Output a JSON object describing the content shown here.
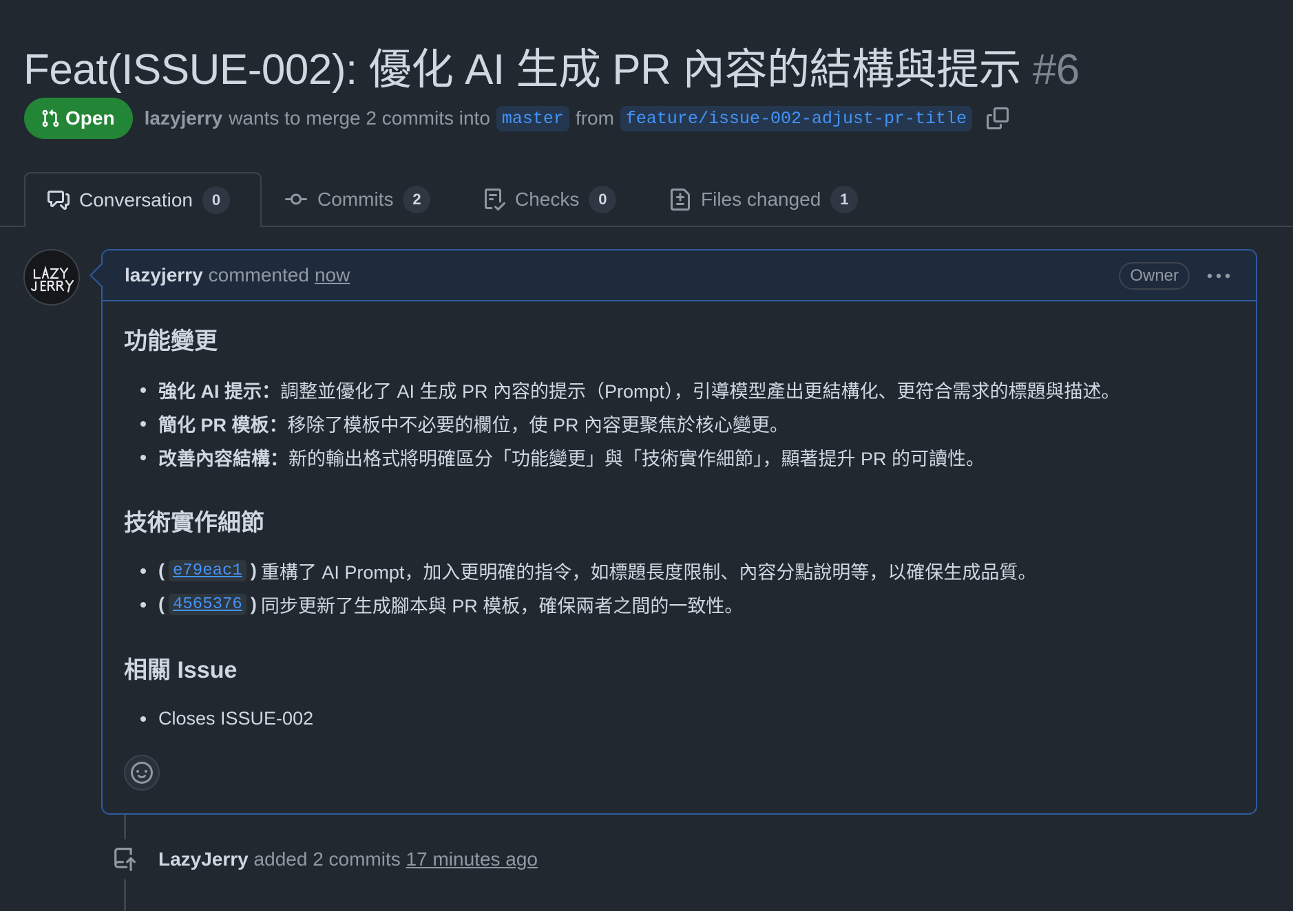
{
  "pr": {
    "title": "Feat(ISSUE-002): 優化 AI 生成 PR 內容的結構與提示",
    "number": "#6",
    "state": "Open",
    "author": "lazyjerry",
    "merge_text": "wants to merge 2 commits into",
    "base_branch": "master",
    "from_text": "from",
    "head_branch": "feature/issue-002-adjust-pr-title"
  },
  "tabs": [
    {
      "label": "Conversation",
      "count": "0",
      "icon": "comment-discussion-icon"
    },
    {
      "label": "Commits",
      "count": "2",
      "icon": "git-commit-icon"
    },
    {
      "label": "Checks",
      "count": "0",
      "icon": "checklist-icon"
    },
    {
      "label": "Files changed",
      "count": "1",
      "icon": "file-diff-icon"
    }
  ],
  "comment": {
    "author": "lazyjerry",
    "action": "commented",
    "time": "now",
    "badge": "Owner",
    "sections": [
      {
        "heading": "功能變更",
        "items": [
          {
            "bold": "強化 AI 提示：",
            "text": " 調整並優化了 AI 生成 PR 內容的提示（Prompt），引導模型產出更結構化、更符合需求的標題與描述。"
          },
          {
            "bold": "簡化 PR 模板：",
            "text": " 移除了模板中不必要的欄位，使 PR 內容更聚焦於核心變更。"
          },
          {
            "bold": "改善內容結構：",
            "text": " 新的輸出格式將明確區分「功能變更」與「技術實作細節」，顯著提升 PR 的可讀性。"
          }
        ]
      },
      {
        "heading": "技術實作細節",
        "items": [
          {
            "sha": "e79eac1",
            "text": "重構了 AI Prompt，加入更明確的指令，如標題長度限制、內容分點說明等，以確保生成品質。"
          },
          {
            "sha": "4565376",
            "text": "同步更新了生成腳本與 PR 模板，確保兩者之間的一致性。"
          }
        ]
      },
      {
        "heading": "相關 Issue",
        "items": [
          {
            "text": "Closes ISSUE-002"
          }
        ]
      }
    ]
  },
  "timeline": {
    "author": "LazyJerry",
    "action": "added 2 commits",
    "time": "17 minutes ago"
  },
  "colors": {
    "background": "#212830",
    "open_green": "#238636",
    "link_blue": "#4493f8",
    "comment_border": "#2f5b9e"
  }
}
